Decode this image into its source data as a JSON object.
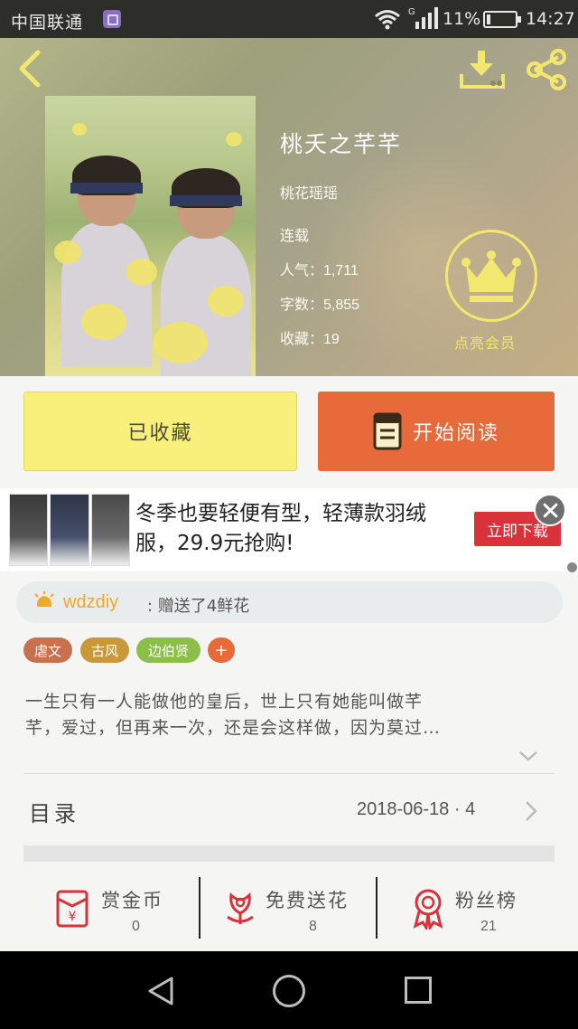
{
  "status_bar": {
    "carrier": "中国联通",
    "network_type": "G",
    "battery_percent": "11%",
    "time": "14:27"
  },
  "book": {
    "title": "桃夭之芊芊",
    "author": "桃花瑶瑶",
    "status": "连载",
    "popularity_label": "人气：",
    "popularity_value": "1,711",
    "wordcount_label": "字数：",
    "wordcount_value": "5,855",
    "favorites_label": "收藏：",
    "favorites_value": "19"
  },
  "vip": {
    "label": "点亮会员",
    "icon": "crown-icon"
  },
  "actions": {
    "collected_label": "已收藏",
    "read_label": "开始阅读"
  },
  "ad": {
    "text": "冬季也要轻便有型，轻薄款羽绒服，29.9元抢购!",
    "cta": "立即下载"
  },
  "gift": {
    "user": "wdzdiy",
    "message": ": 赠送了4鲜花"
  },
  "tags": [
    {
      "label": "虐文",
      "color": "#c9704e"
    },
    {
      "label": "古风",
      "color": "#c9983a"
    },
    {
      "label": "边伯贤",
      "color": "#8cbf4a"
    }
  ],
  "tag_add_label": "+",
  "description": {
    "line1": "一生只有一人能做他的皇后，世上只有她能叫做芊",
    "line2": "芊，爱过，但再来一次，还是会这样做，因为莫过…"
  },
  "catalog": {
    "title": "目录",
    "info": "2018-06-18  ·  4"
  },
  "stats": [
    {
      "label": "赏金币",
      "value": "0",
      "icon": "red-envelope-icon"
    },
    {
      "label": "免费送花",
      "value": "8",
      "icon": "flower-icon"
    },
    {
      "label": "粉丝榜",
      "value": "21",
      "icon": "medal-icon"
    }
  ],
  "colors": {
    "accent_orange": "#e8693a",
    "collected_yellow": "#f9f07b",
    "vip_yellow": "#f2e870",
    "stat_red": "#d9323b"
  }
}
